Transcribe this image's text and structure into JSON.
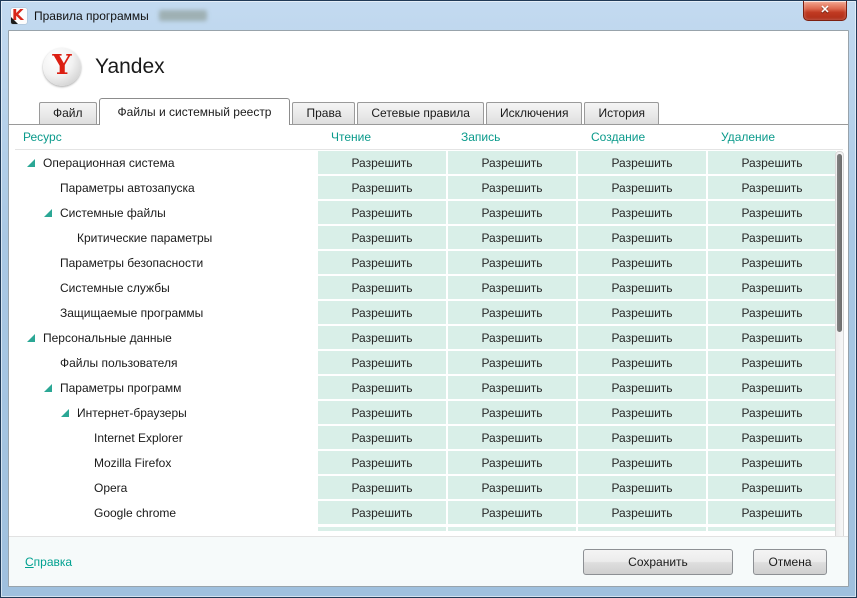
{
  "window": {
    "title": "Правила программы"
  },
  "icons": {
    "close": "✕",
    "app": "K",
    "brand_letter": "Y",
    "expander": "lower-right-triangle"
  },
  "colors": {
    "accent_teal": "#0a9a8b",
    "cell_bg": "#d9efe8",
    "close_red": "#c03a22",
    "expander_teal": "#2ba795"
  },
  "brand": {
    "name": "Yandex"
  },
  "tabs": [
    {
      "label": "Файл",
      "active": false
    },
    {
      "label": "Файлы и системный реестр",
      "active": true
    },
    {
      "label": "Права",
      "active": false
    },
    {
      "label": "Сетевые правила",
      "active": false
    },
    {
      "label": "Исключения",
      "active": false
    },
    {
      "label": "История",
      "active": false
    }
  ],
  "table": {
    "columns": [
      "Ресурс",
      "Чтение",
      "Запись",
      "Создание",
      "Удаление"
    ],
    "rows": [
      {
        "label": "Операционная система",
        "level": 0,
        "expander": true,
        "permissions": [
          "Разрешить",
          "Разрешить",
          "Разрешить",
          "Разрешить"
        ]
      },
      {
        "label": "Параметры автозапуска",
        "level": 1,
        "expander": false,
        "permissions": [
          "Разрешить",
          "Разрешить",
          "Разрешить",
          "Разрешить"
        ]
      },
      {
        "label": "Системные файлы",
        "level": 1,
        "expander": true,
        "permissions": [
          "Разрешить",
          "Разрешить",
          "Разрешить",
          "Разрешить"
        ]
      },
      {
        "label": "Критические параметры",
        "level": 2,
        "expander": false,
        "permissions": [
          "Разрешить",
          "Разрешить",
          "Разрешить",
          "Разрешить"
        ]
      },
      {
        "label": "Параметры безопасности",
        "level": 1,
        "expander": false,
        "permissions": [
          "Разрешить",
          "Разрешить",
          "Разрешить",
          "Разрешить"
        ]
      },
      {
        "label": "Системные службы",
        "level": 1,
        "expander": false,
        "permissions": [
          "Разрешить",
          "Разрешить",
          "Разрешить",
          "Разрешить"
        ]
      },
      {
        "label": "Защищаемые программы",
        "level": 1,
        "expander": false,
        "permissions": [
          "Разрешить",
          "Разрешить",
          "Разрешить",
          "Разрешить"
        ]
      },
      {
        "label": "Персональные данные",
        "level": 0,
        "expander": true,
        "permissions": [
          "Разрешить",
          "Разрешить",
          "Разрешить",
          "Разрешить"
        ]
      },
      {
        "label": "Файлы пользователя",
        "level": 1,
        "expander": false,
        "permissions": [
          "Разрешить",
          "Разрешить",
          "Разрешить",
          "Разрешить"
        ]
      },
      {
        "label": "Параметры программ",
        "level": 1,
        "expander": true,
        "permissions": [
          "Разрешить",
          "Разрешить",
          "Разрешить",
          "Разрешить"
        ]
      },
      {
        "label": "Интернет-браузеры",
        "level": 2,
        "expander": true,
        "permissions": [
          "Разрешить",
          "Разрешить",
          "Разрешить",
          "Разрешить"
        ]
      },
      {
        "label": "Internet Explorer",
        "level": 3,
        "expander": false,
        "permissions": [
          "Разрешить",
          "Разрешить",
          "Разрешить",
          "Разрешить"
        ]
      },
      {
        "label": "Mozilla Firefox",
        "level": 3,
        "expander": false,
        "permissions": [
          "Разрешить",
          "Разрешить",
          "Разрешить",
          "Разрешить"
        ]
      },
      {
        "label": "Opera",
        "level": 3,
        "expander": false,
        "permissions": [
          "Разрешить",
          "Разрешить",
          "Разрешить",
          "Разрешить"
        ]
      },
      {
        "label": "Google chrome",
        "level": 3,
        "expander": false,
        "permissions": [
          "Разрешить",
          "Разрешить",
          "Разрешить",
          "Разрешить"
        ]
      }
    ]
  },
  "footer": {
    "help_accesskey": "С",
    "help_rest": "правка",
    "save_label": "Сохранить",
    "cancel_label": "Отмена"
  }
}
